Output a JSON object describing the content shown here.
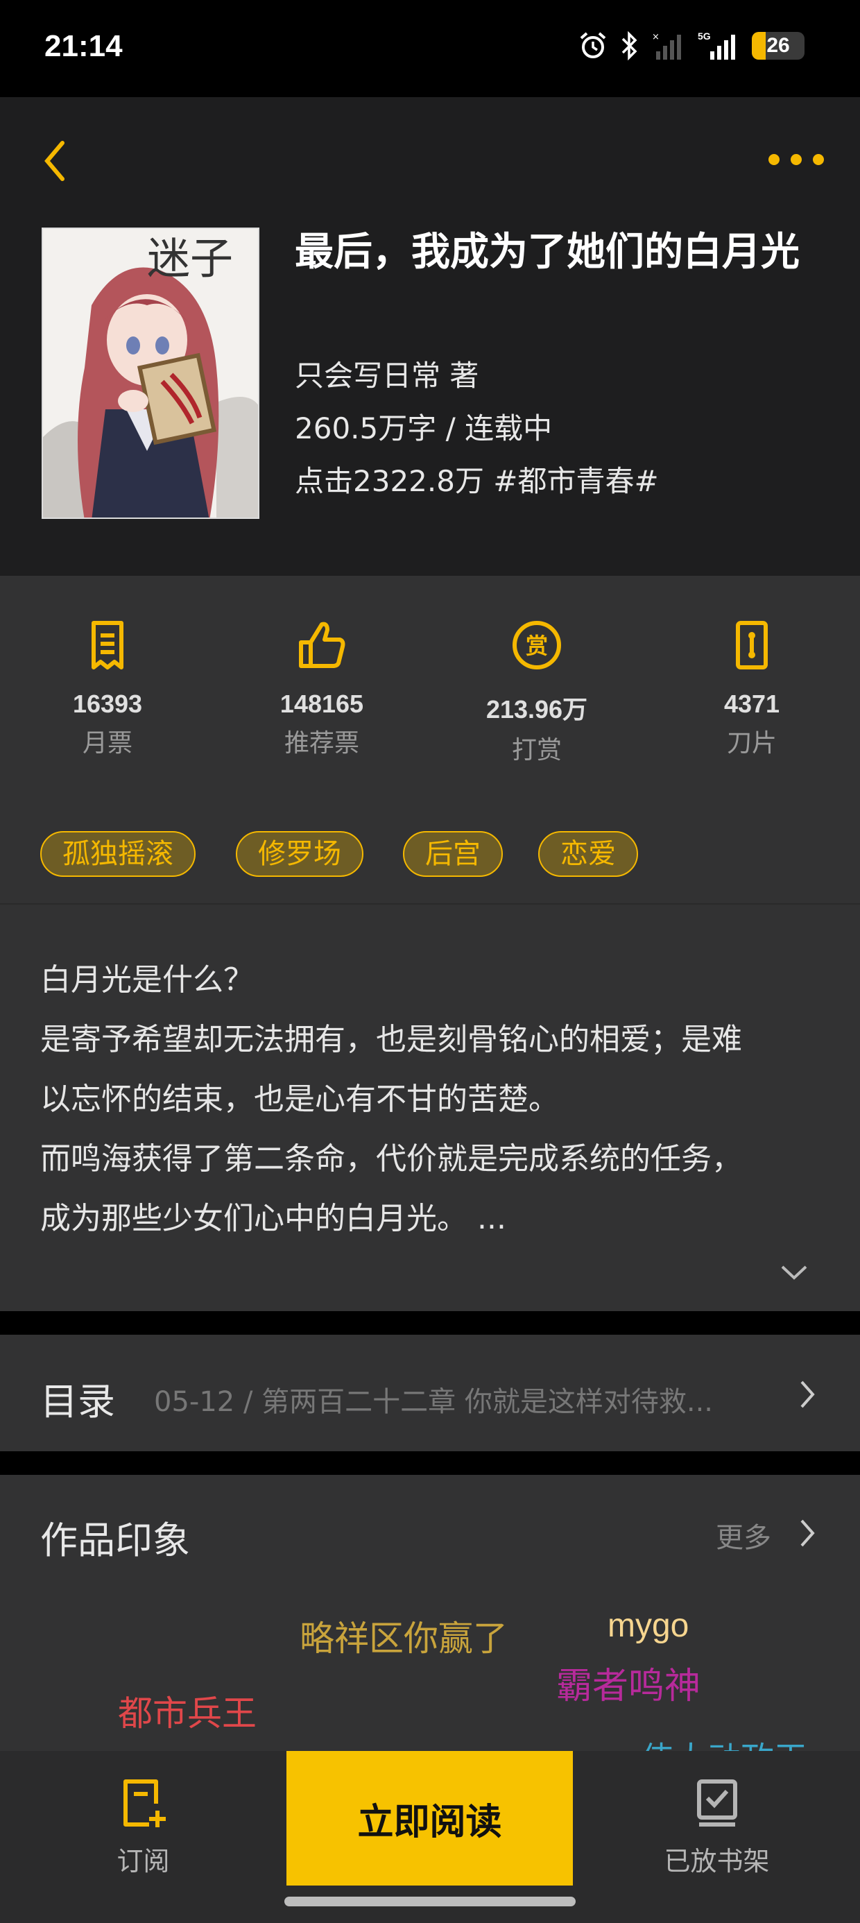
{
  "status_bar": {
    "time": "21:14",
    "network": "5G",
    "battery": "26",
    "battery_level": 0.26
  },
  "book": {
    "cover_title": "迷子",
    "title": "最后，我成为了她们的白月光",
    "author": "只会写日常  著",
    "words_status": "260.5万字 / 连载中",
    "clicks_category": "点击2322.8万  #都市青春#"
  },
  "stats": [
    {
      "icon": "monthly-ticket-icon",
      "value": "16393",
      "label": "月票"
    },
    {
      "icon": "thumbs-up-icon",
      "value": "148165",
      "label": "推荐票"
    },
    {
      "icon": "reward-coin-icon",
      "value": "213.96万",
      "label": "打赏"
    },
    {
      "icon": "blade-icon",
      "value": "4371",
      "label": "刀片"
    }
  ],
  "tags": [
    "孤独摇滚",
    "修罗场",
    "后宫",
    "恋爱"
  ],
  "description": {
    "lines": [
      "白月光是什么？",
      "是寄予希望却无法拥有，也是刻骨铭心的相爱；是难",
      "以忘怀的结束，也是心有不甘的苦楚。",
      "而鸣海获得了第二条命，代价就是完成系统的任务，",
      "成为那些少女们心中的白月光。 ..."
    ]
  },
  "catalog": {
    "title": "目录",
    "latest": "05-12 / 第两百二十二章 你就是这样对待救..."
  },
  "impression": {
    "title": "作品印象",
    "more": "更多",
    "words": [
      {
        "text": "略祥区你赢了",
        "color": "#c9a43c"
      },
      {
        "text": "mygo",
        "color": "#f6d58f"
      },
      {
        "text": "霸者鸣神",
        "color": "#b72a9b"
      },
      {
        "text": "都市兵王",
        "color": "#e0474a"
      },
      {
        "text": "伟大动政王",
        "color": "#3aa6c9"
      }
    ]
  },
  "bottom_bar": {
    "subscribe": "订阅",
    "read_now": "立即阅读",
    "on_shelf": "已放书架"
  },
  "colors": {
    "accent": "#f5b800",
    "background": "#323233",
    "header": "#1e1e1f"
  }
}
